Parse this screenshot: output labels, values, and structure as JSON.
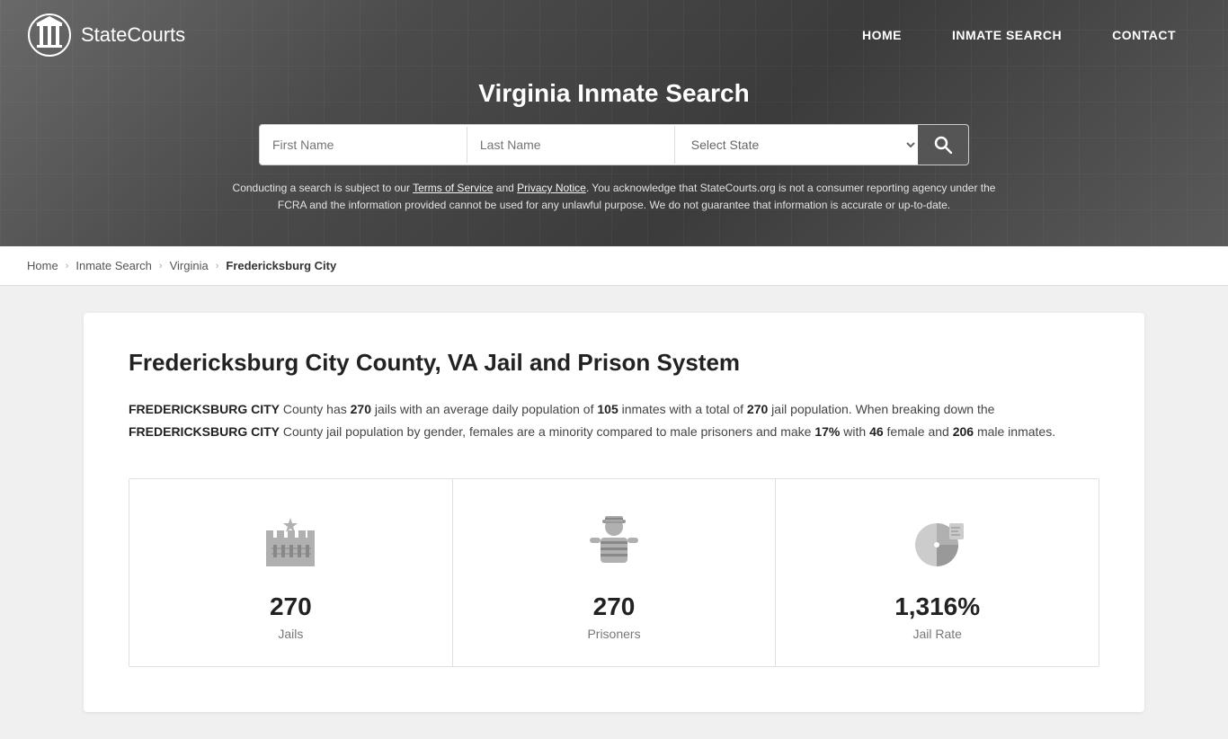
{
  "site": {
    "name": "StateCourts",
    "name_part1": "State",
    "name_part2": "Courts"
  },
  "nav": {
    "home_label": "HOME",
    "inmate_search_label": "INMATE SEARCH",
    "contact_label": "CONTACT"
  },
  "hero": {
    "title": "Virginia Inmate Search",
    "first_name_placeholder": "First Name",
    "last_name_placeholder": "Last Name",
    "state_select_label": "Select State",
    "disclaimer": "Conducting a search is subject to our Terms of Service and Privacy Notice. You acknowledge that StateCourts.org is not a consumer reporting agency under the FCRA and the information provided cannot be used for any unlawful purpose. We do not guarantee that information is accurate or up-to-date."
  },
  "breadcrumb": {
    "home": "Home",
    "inmate_search": "Inmate Search",
    "virginia": "Virginia",
    "current": "Fredericksburg City"
  },
  "content": {
    "title": "Fredericksburg City County, VA Jail and Prison System",
    "description_parts": {
      "county_name": "FREDERICKSBURG CITY",
      "jails_count": "270",
      "avg_daily_pop": "105",
      "total_jail_pop": "270",
      "county_name2": "FREDERICKSBURG CITY",
      "female_pct": "17%",
      "female_count": "46",
      "male_count": "206"
    }
  },
  "stats": {
    "jails": {
      "value": "270",
      "label": "Jails"
    },
    "prisoners": {
      "value": "270",
      "label": "Prisoners"
    },
    "jail_rate": {
      "value": "1,316%",
      "label": "Jail Rate"
    }
  }
}
